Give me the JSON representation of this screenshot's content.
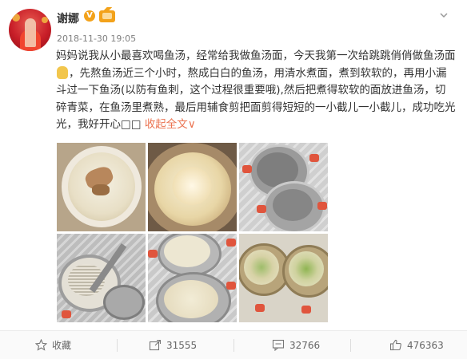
{
  "user": {
    "name": "谢娜",
    "verified_badge": "V",
    "timestamp": "2018-11-30 19:05"
  },
  "post": {
    "text_part1": "妈妈说我从小最喜欢喝鱼汤，经常给我做鱼汤面，今天我第一次给跳跳俏俏做鱼汤面",
    "text_part2": "，先熬鱼汤近三个小时，熬成白白的鱼汤，用清水煮面，煮到软软的，再用小漏斗过一下鱼汤(以防有鱼刺，这个过程很重要哦),然后把煮得软软的面放进鱼汤，切碎青菜，在鱼汤里煮熟，最后用辅食剪把面剪得短短的一小截儿一小截儿，成功吃光光，我好开心",
    "text_boxes": "□□",
    "collapse_label": "收起全文",
    "collapse_arrow": "∨"
  },
  "photos": [
    {
      "subject": "fish-soup-bowl"
    },
    {
      "subject": "boiling-fish-soup-pot"
    },
    {
      "subject": "two-empty-bowls"
    },
    {
      "subject": "strainer-ladle"
    },
    {
      "subject": "two-bowls-noodles"
    },
    {
      "subject": "two-bowls-greens"
    }
  ],
  "footer": {
    "favorite_label": "收藏",
    "share_count": "31555",
    "comment_count": "32766",
    "like_count": "476363"
  },
  "colors": {
    "accent": "#eb7350",
    "badge": "#f3a21a",
    "text": "#333333",
    "meta": "#808080"
  }
}
